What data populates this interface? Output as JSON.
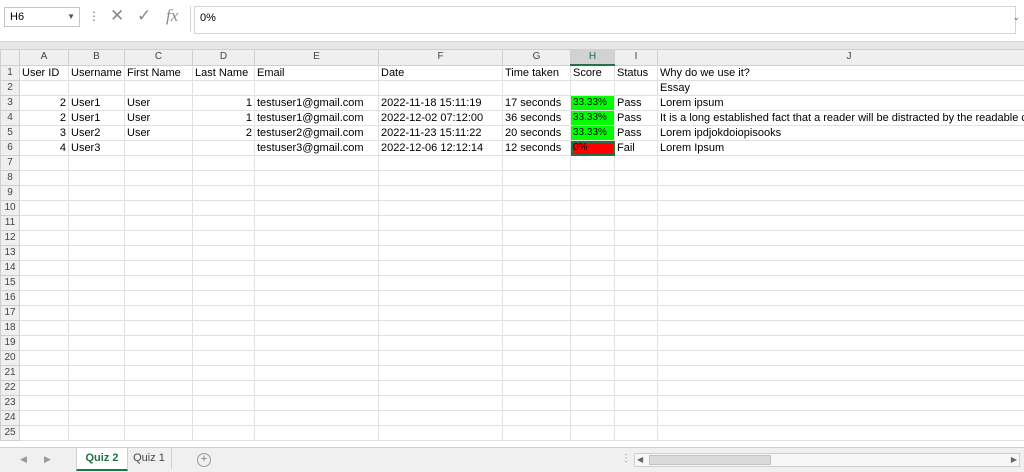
{
  "formula_bar": {
    "name_box": "H6",
    "formula": "0%",
    "cancel_icon": "close-icon",
    "enter_icon": "check-icon",
    "fx_label": "fx"
  },
  "columns": [
    "A",
    "B",
    "C",
    "D",
    "E",
    "F",
    "G",
    "H",
    "I",
    "J"
  ],
  "selected_column": "H",
  "rows": [
    {
      "num": "1",
      "A": "User ID",
      "B": "Username",
      "C": "First Name",
      "D": "Last Name",
      "E": "Email",
      "F": "Date",
      "G": "Time taken",
      "H": "Score",
      "I": "Status",
      "J": "Why do we use it?"
    },
    {
      "num": "2",
      "A": "",
      "B": "",
      "C": "",
      "D": "",
      "E": "",
      "F": "",
      "G": "",
      "H": "",
      "I": "",
      "J": "Essay"
    },
    {
      "num": "3",
      "A": "2",
      "B": "User1",
      "C": "User",
      "D": "1",
      "E": "testuser1@gmail.com",
      "F": "2022-11-18 15:11:19",
      "G": "17 seconds",
      "H": "33.33%",
      "I": "Pass",
      "J": "Lorem ipsum"
    },
    {
      "num": "4",
      "A": "2",
      "B": "User1",
      "C": "User",
      "D": "1",
      "E": "testuser1@gmail.com",
      "F": "2022-12-02 07:12:00",
      "G": "36 seconds",
      "H": "33.33%",
      "I": "Pass",
      "J": "It is a long established fact that a reader will be distracted by the readable co"
    },
    {
      "num": "5",
      "A": "3",
      "B": "User2",
      "C": "User",
      "D": "2",
      "E": "testuser2@gmail.com",
      "F": "2022-11-23 15:11:22",
      "G": "20 seconds",
      "H": "33.33%",
      "I": "Pass",
      "J": "Lorem ipdjokdoiopisooks"
    },
    {
      "num": "6",
      "A": "4",
      "B": "User3",
      "C": "",
      "D": "",
      "E": "testuser3@gmail.com",
      "F": "2022-12-06 12:12:14",
      "G": "12 seconds",
      "H": "0%",
      "I": "Fail",
      "J": "Lorem Ipsum"
    }
  ],
  "empty_rows": [
    "7",
    "8",
    "9",
    "10",
    "11",
    "12",
    "13",
    "14",
    "15",
    "16",
    "17",
    "18",
    "19",
    "20",
    "21",
    "22",
    "23",
    "24",
    "25"
  ],
  "score_colors": {
    "pass": "#00ff00",
    "fail": "#ff0000"
  },
  "accent_color": "#217346",
  "sheet_tabs": [
    {
      "label": "Quiz 2",
      "active": true
    },
    {
      "label": "Quiz 1",
      "active": false
    }
  ]
}
